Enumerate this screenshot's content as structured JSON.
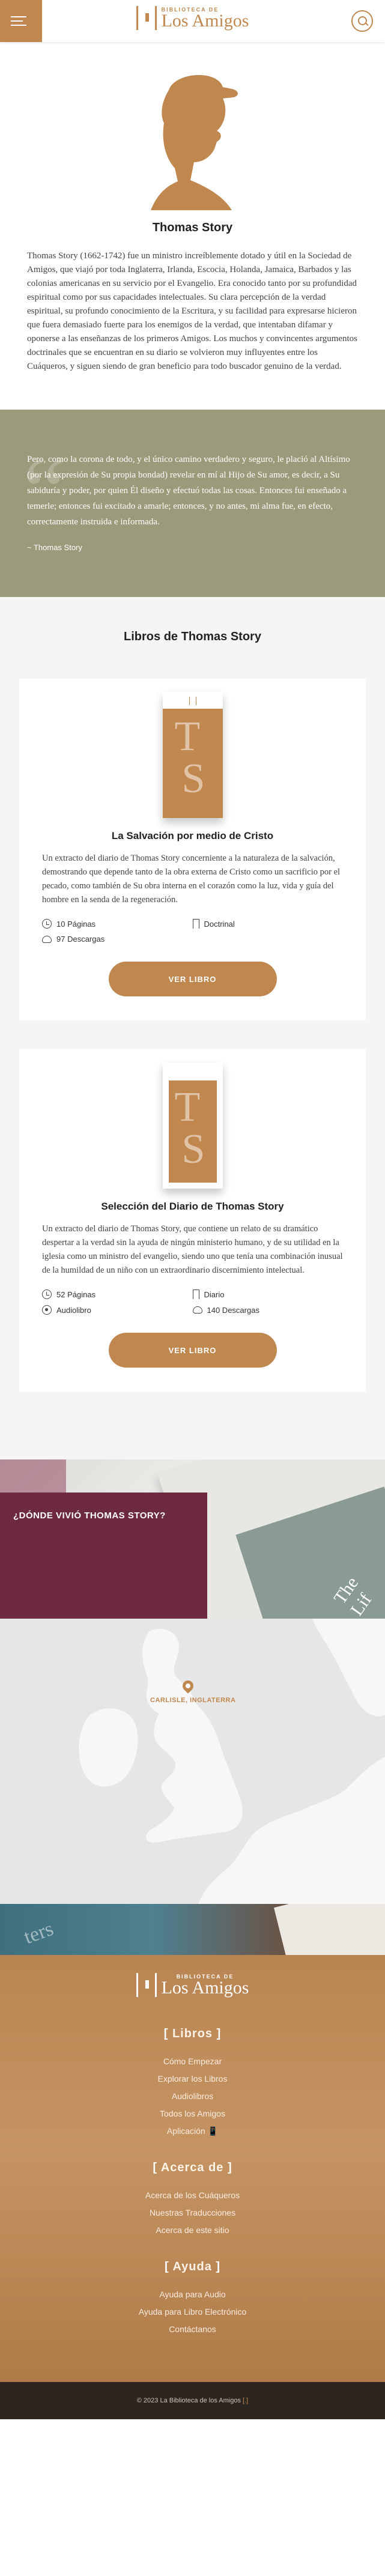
{
  "header": {
    "logo_small": "BIBLIOTECA DE",
    "logo_big": "Los Amigos"
  },
  "author": {
    "name": "Thomas Story",
    "bio": "Thomas Story (1662-1742) fue un ministro increíblemente dotado y útil en la Sociedad de Amigos, que viajó por toda Inglaterra, Irlanda, Escocia, Holanda, Jamaica, Barbados y las colonias americanas en su servicio por el Evangelio. Era conocido tanto por su profundidad espiritual como por sus capacidades intelectuales. Su clara percepción de la verdad espiritual, su profundo conocimiento de la Escritura, y su facilidad para expresarse hicieron que fuera demasiado fuerte para los enemigos de la verdad, que intentaban difamar y oponerse a las enseñanzas de los primeros Amigos. Los muchos y convincentes argumentos doctrinales que se encuentran en su diario se volvieron muy influyentes entre los Cuáqueros, y siguen siendo de gran beneficio para todo buscador genuino de la verdad."
  },
  "quote": {
    "text": "Pero, como la corona de todo, y el único camino verdadero y seguro, le plació al Altísimo (por la expresión de Su propia bondad) revelar en mí al Hijo de Su amor, es decir, a Su sabiduría y poder, por quien Él diseño y efectuó todas las cosas. Entonces fui enseñado a temerle; entonces fui excitado a amarle; entonces, y no antes, mi alma fue, en efecto, correctamente instruida e informada.",
    "author": "~ Thomas Story"
  },
  "books_section": {
    "title": "Libros de Thomas Story",
    "books": [
      {
        "title": "La Salvación por medio de Cristo",
        "description": "Un extracto del diario de Thomas Story concerniente a la naturaleza de la salvación, demostrando que depende tanto de la obra externa de Cristo como un sacrificio por el pecado, como también de Su obra interna en el corazón como la luz, vida y guía del hombre en la senda de la regeneración.",
        "pages": "10 Páginas",
        "category": "Doctrinal",
        "downloads": "97 Descargas",
        "button": "VER LIBRO"
      },
      {
        "title": "Selección del Diario de Thomas Story",
        "description": "Un extracto del diario de Thomas Story, que contiene un relato de su dramático despertar a la verdad sin la ayuda de ningún ministerio humano, y de su utilidad en la iglesia como un ministro del evangelio, siendo uno que tenía una combinación inusual de la humildad de un niño con un extraordinario discernimiento intelectual.",
        "pages": "52 Páginas",
        "category": "Diario",
        "audio": "Audiolibro",
        "downloads": "140 Descargas",
        "button": "VER LIBRO"
      }
    ]
  },
  "where": {
    "title": "¿DÓNDE VIVIÓ THOMAS STORY?",
    "deco_text": "The Lif"
  },
  "map": {
    "label": "CARLISLE, INGLATERRA"
  },
  "footer": {
    "deco_text": "ters",
    "logo_small": "BIBLIOTECA DE",
    "logo_big": "Los Amigos",
    "sections": [
      {
        "title": "Libros",
        "links": [
          "Cómo Empezar",
          "Explorar los Libros",
          "Audiolibros",
          "Todos los Amigos",
          "Aplicación 📱"
        ]
      },
      {
        "title": "Acerca de",
        "links": [
          "Acerca de los Cuáqueros",
          "Nuestras Traducciones",
          "Acerca de este sitio"
        ]
      },
      {
        "title": "Ayuda",
        "links": [
          "Ayuda para Audio",
          "Ayuda para Libro Electrónico",
          "Contáctanos"
        ]
      }
    ],
    "copyright_pre": "© 2023 La Biblioteca de los Amigos",
    "copyright_mark": "[.]"
  },
  "colors": {
    "accent": "#c0874f",
    "quote_bg": "#9a9b7a",
    "where_box": "#6d2a3e",
    "copyright_bg": "#2c2520"
  },
  "icons": [
    "menu-icon",
    "search-icon",
    "clock-icon",
    "bookmark-icon",
    "cloud-download-icon",
    "headphones-icon",
    "map-pin-icon"
  ]
}
